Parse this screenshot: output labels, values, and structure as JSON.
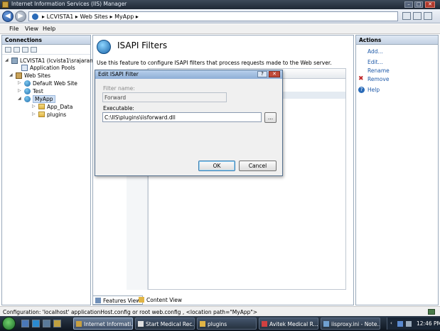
{
  "window": {
    "title": "Internet Information Services (IIS) Manager"
  },
  "address": {
    "crumbs": [
      "LCVISTA1",
      "Web Sites",
      "MyApp"
    ],
    "separator": "▸"
  },
  "menu": {
    "items": [
      "File",
      "View",
      "Help"
    ]
  },
  "connections": {
    "header": "Connections",
    "tree": {
      "server": "LCVISTA1 (lcvista1\\srajaram)",
      "app_pools": "Application Pools",
      "web_sites": "Web Sites",
      "default_site": "Default Web Site",
      "test": "Test",
      "myapp": "MyApp",
      "app_data": "App_Data",
      "plugins": "plugins"
    }
  },
  "feature": {
    "title": "ISAPI Filters",
    "description": "Use this feature to configure ISAPI filters that process requests made to the Web server.",
    "column_type": "ype"
  },
  "bottom_tabs": {
    "features_view": "Features View",
    "content_view": "Content View"
  },
  "actions": {
    "header": "Actions",
    "add": "Add...",
    "edit": "Edit...",
    "rename": "Rename",
    "remove": "Remove",
    "help": "Help"
  },
  "dialog": {
    "title": "Edit ISAPI Filter",
    "help_btn": "?",
    "close_btn": "✕",
    "filter_name_label": "Filter name:",
    "filter_name_value": "Forward",
    "executable_label": "Executable:",
    "executable_value": "C:\\IIS\\plugins\\iisforward.dll",
    "browse_label": "...",
    "ok_label": "OK",
    "cancel_label": "Cancel"
  },
  "status": {
    "text": "Configuration: 'localhost' applicationHost.config or root web.config , <location path=\"MyApp\">"
  },
  "taskbar": {
    "tasks": [
      "Internet Informati...",
      "Start Medical Rec...",
      "plugins",
      "Avitek Medical R...",
      "iisproxy.ini - Note..."
    ],
    "clock": "12:46 PM"
  },
  "colors": {
    "accent": "#1f5aa8",
    "remove_red": "#c0282a",
    "title_bar": "#2a3646"
  }
}
